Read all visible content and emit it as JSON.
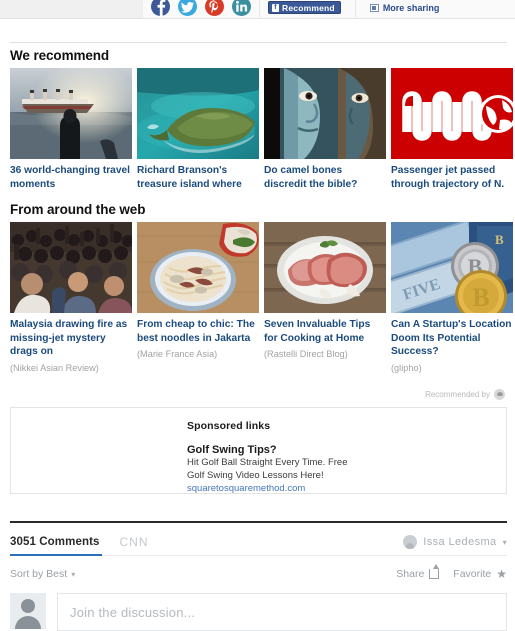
{
  "share_bar": {
    "social_icons": [
      {
        "name": "facebook-share-icon",
        "glyph": "f",
        "color": "#3b5998"
      },
      {
        "name": "twitter-share-icon",
        "glyph": "t",
        "color": "#3aa9e0"
      },
      {
        "name": "pinterest-share-icon",
        "glyph": "P",
        "color": "#d73b27"
      },
      {
        "name": "linkedin-share-icon",
        "glyph": "in",
        "color": "#3a8fa0"
      }
    ],
    "recommend_label": "Recommend",
    "recommend_glyph": "f",
    "more_sharing_label": "More sharing"
  },
  "sections": {
    "we_recommend": {
      "heading": "We recommend",
      "cards": [
        {
          "title": "36 world-changing travel moments",
          "source": "",
          "image": "titanic-ship-photo"
        },
        {
          "title": "Richard Branson's treasure island where",
          "source": "",
          "image": "tropical-island-aerial-photo"
        },
        {
          "title": "Do camel bones discredit the bible?",
          "source": "",
          "image": "ancient-painted-faces-photo"
        },
        {
          "title": "Passenger jet passed through trajectory of N.",
          "source": "",
          "image": "cnn-logo-graphic"
        }
      ]
    },
    "from_around_the_web": {
      "heading": "From around the web",
      "cards": [
        {
          "title": "Malaysia drawing fire as missing-jet mystery drags on",
          "source": "(Nikkei Asian Review)",
          "image": "protest-crowd-photo"
        },
        {
          "title": "From cheap to chic: The best noodles in Jakarta",
          "source": "(Marie France Asia)",
          "image": "noodle-bowl-photo"
        },
        {
          "title": "Seven Invaluable Tips for Cooking at Home",
          "source": "(Rastelli Direct Blog)",
          "image": "raw-steak-plate-photo"
        },
        {
          "title": "Can A Startup's Location Doom Its Potential Success?",
          "source": "(glipho)",
          "image": "bitcoin-coins-photo"
        }
      ]
    }
  },
  "recommended_by": {
    "label": "Recommended by",
    "logo": "outbrain-logo"
  },
  "sponsored": {
    "heading": "Sponsored links",
    "title": "Golf Swing Tips?",
    "description_line1": "Hit Golf Ball Straight Every Time. Free",
    "description_line2": "Golf Swing Video Lessons Here!",
    "url": "squaretosquaremethod.com"
  },
  "comments": {
    "count_label": "3051 Comments",
    "site_label": "CNN",
    "user_name": "Issa Ledesma",
    "user_caret": "▾",
    "sort_label": "Sort by Best",
    "sort_caret": "▾",
    "share_label": "Share",
    "favorite_label": "Favorite",
    "favorite_glyph": "★",
    "compose_placeholder": "Join the discussion..."
  },
  "colors": {
    "link_blue": "#1b4b7d",
    "facebook_blue": "#3b5998",
    "accent_underline": "#2a6fb7",
    "muted_gray": "#a3a3a3",
    "cnn_red": "#cc0000"
  }
}
